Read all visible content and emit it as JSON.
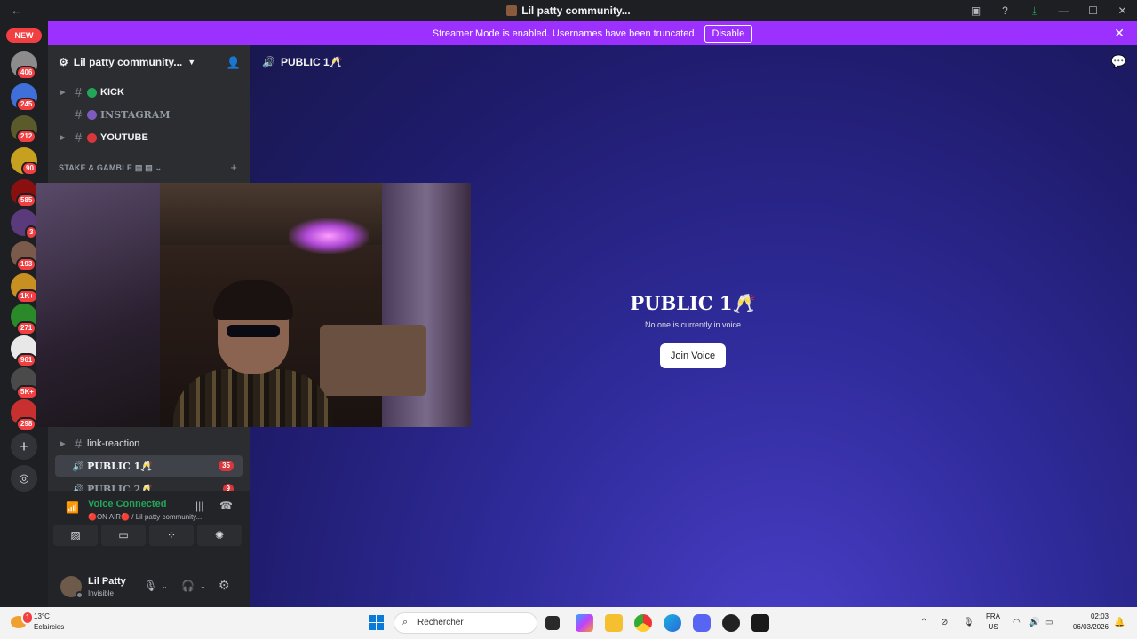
{
  "window": {
    "title": "Lil patty community...",
    "back_glyph": "←"
  },
  "banner": {
    "message": "Streamer Mode is enabled. Usernames have been truncated.",
    "disable_label": "Disable"
  },
  "server_rail": {
    "new_label": "NEW",
    "badges": [
      "406",
      "245",
      "212",
      "90",
      "585",
      "3",
      "193",
      "1K+",
      "271",
      "961",
      "5K+",
      "298"
    ]
  },
  "guild": {
    "name": "Lil patty community..."
  },
  "channels": {
    "top": [
      {
        "name": "KICK",
        "dot_color": "#23a55a"
      },
      {
        "name": "INSTAGRAM",
        "dot_color": "#7d5bbe"
      },
      {
        "name": "YOUTUBE",
        "dot_color": "#da373c"
      }
    ],
    "category": "STAKE & GAMBLE",
    "bottom": [
      {
        "name": "link-reaction"
      },
      {
        "name": "PUBLIC 1🥂",
        "count": "35"
      },
      {
        "name": "PUBLIC 2🥂",
        "count": "9"
      }
    ]
  },
  "voice": {
    "status": "Voice Connected",
    "sub": "🔴ON AIR🔴 / Lil patty community..."
  },
  "user": {
    "name": "Lil Patty",
    "status": "Invisible"
  },
  "main": {
    "header": "PUBLIC 1🥂",
    "title": "PUBLIC 1🥂",
    "desc": "No one is currently in voice",
    "join_label": "Join Voice"
  },
  "taskbar": {
    "temp": "13°C",
    "condition": "Eclaircies",
    "weather_badge": "1",
    "search_placeholder": "Rechercher",
    "lang_top": "FRA",
    "lang_bottom": "US",
    "time": "02:03",
    "date": "06/03/2026"
  }
}
